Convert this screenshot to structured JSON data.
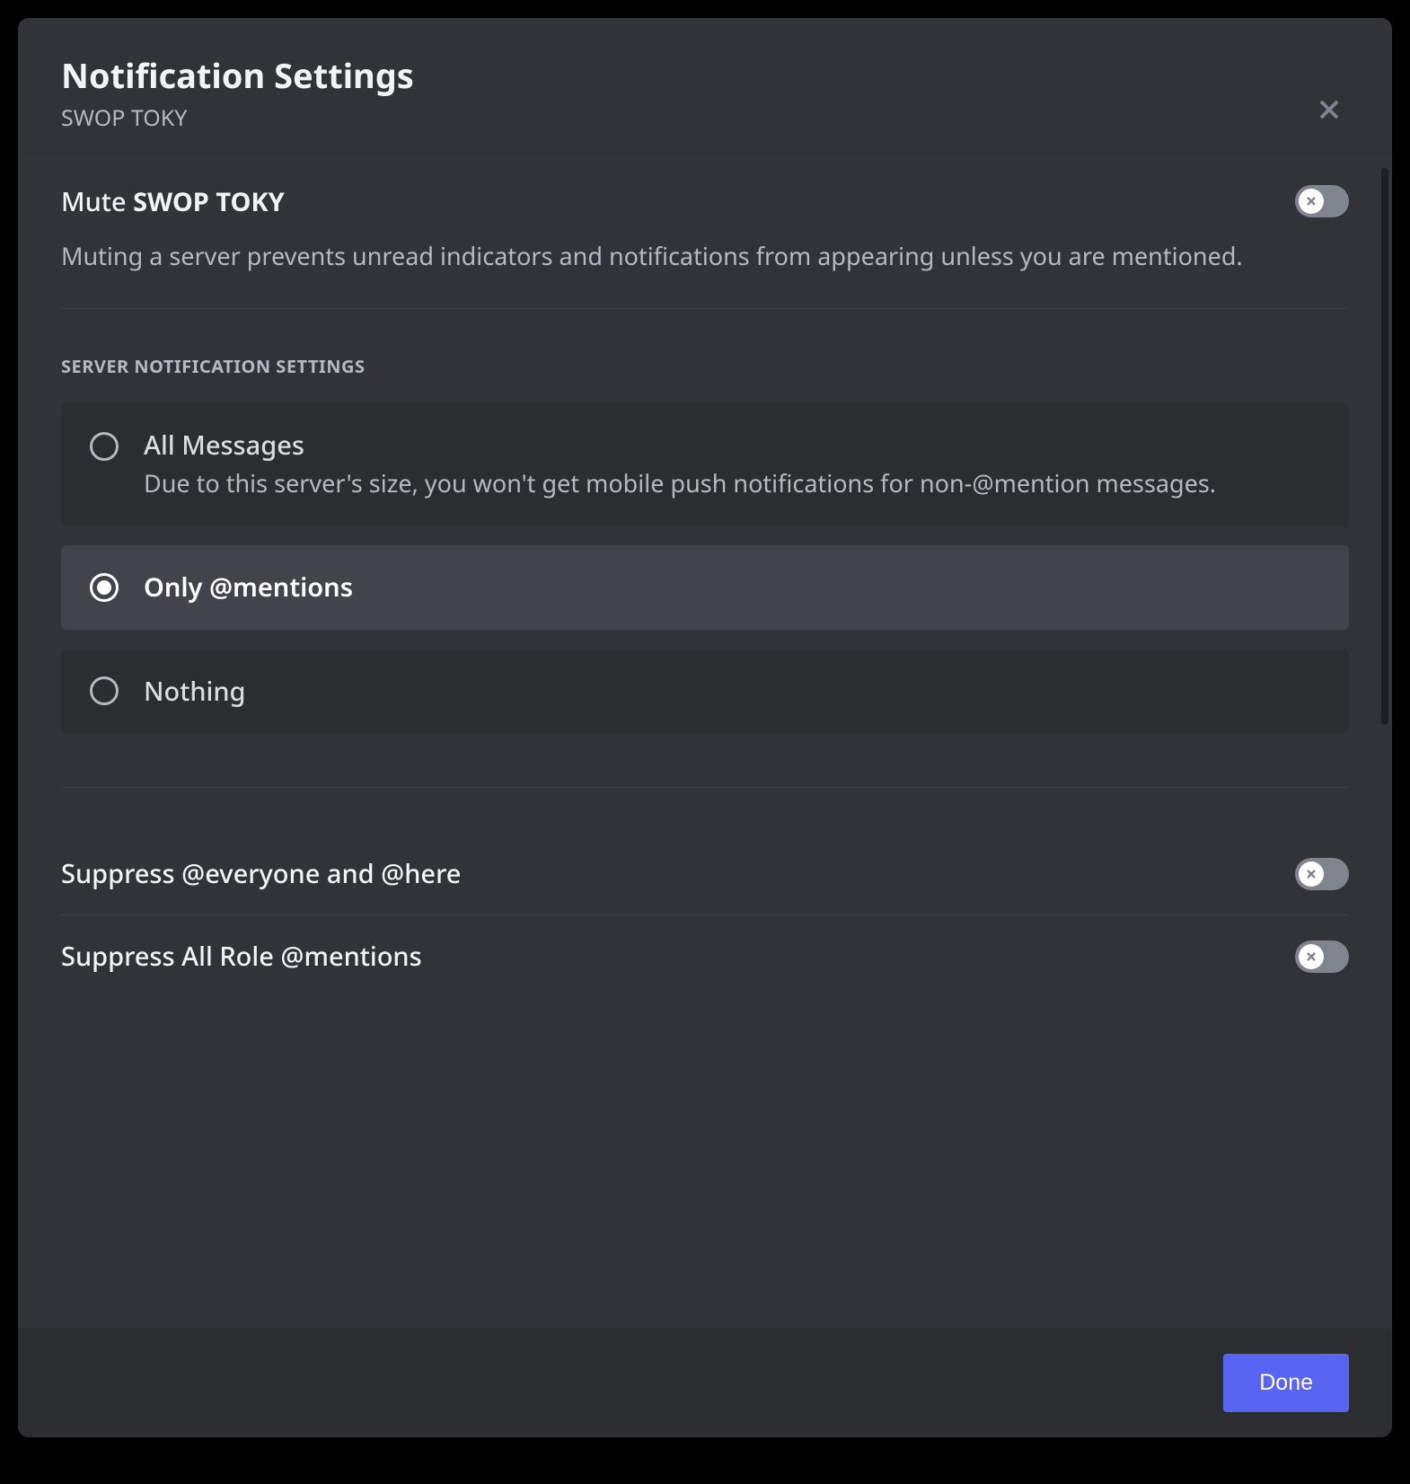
{
  "header": {
    "title": "Notification Settings",
    "subtitle": "SWOP TOKY"
  },
  "mute": {
    "label_prefix": "Mute ",
    "label_bold": "SWOP TOKY",
    "description": "Muting a server prevents unread indicators and notifications from appearing unless you are mentioned."
  },
  "server_settings": {
    "heading": "SERVER NOTIFICATION SETTINGS",
    "options": [
      {
        "title": "All Messages",
        "subtext": "Due to this server's size, you won't get mobile push notifications for non-@mention messages.",
        "selected": false
      },
      {
        "title": "Only @mentions",
        "subtext": "",
        "selected": true
      },
      {
        "title": "Nothing",
        "subtext": "",
        "selected": false
      }
    ]
  },
  "toggles": {
    "suppress_everyone": "Suppress @everyone and @here",
    "suppress_roles": "Suppress All Role @mentions"
  },
  "footer": {
    "done": "Done"
  }
}
